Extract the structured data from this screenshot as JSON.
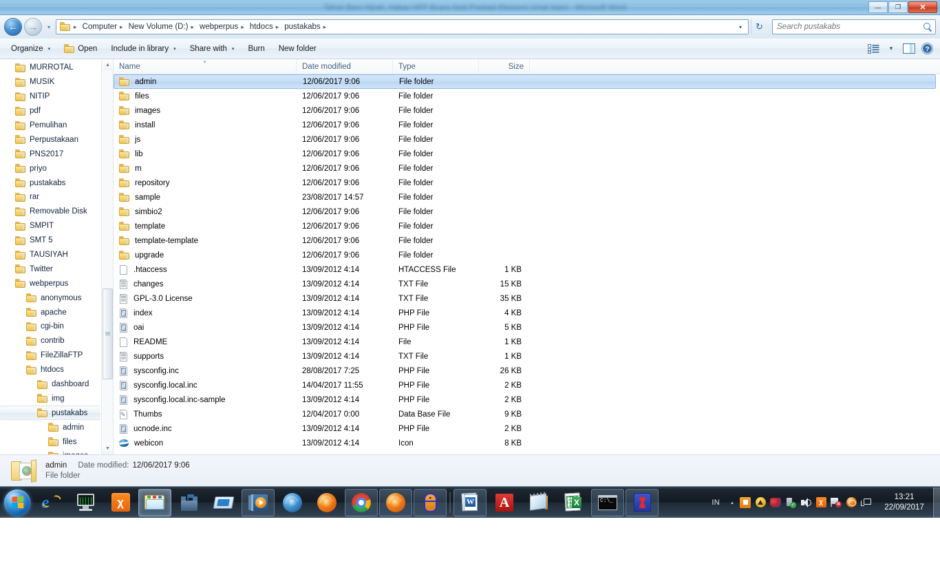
{
  "background_window": {
    "title": "Tahun Baru Hijrah, Hakau HPP Bcara Soal Prestasi Ekonomi Umat Islam - Microsoft Word",
    "minimize_label": "—",
    "restore_label": "❐",
    "close_label": "✕"
  },
  "explorer": {
    "nav": {
      "back_label": "←",
      "forward_label": "→",
      "history_label": "▾"
    },
    "breadcrumb": {
      "separator": "▸",
      "items": [
        "Computer",
        "New Volume (D:)",
        "webperpus",
        "htdocs",
        "pustakabs"
      ],
      "dropdown_label": "▾",
      "refresh_label": "↻"
    },
    "search": {
      "placeholder": "Search pustakabs",
      "value": ""
    },
    "toolbar": {
      "organize": "Organize",
      "open": "Open",
      "include_in_library": "Include in library",
      "share_with": "Share with",
      "burn": "Burn",
      "new_folder": "New folder",
      "caret": "▾",
      "view_icon": "view-options-icon",
      "preview_icon": "preview-pane-icon",
      "help_icon": "help-icon",
      "help_label": "?"
    },
    "sidebar": {
      "items": [
        {
          "label": "MURROTAL",
          "indent": 1
        },
        {
          "label": "MUSIK",
          "indent": 1
        },
        {
          "label": "NITIP",
          "indent": 1
        },
        {
          "label": "pdf",
          "indent": 1
        },
        {
          "label": "Pemulihan",
          "indent": 1
        },
        {
          "label": "Perpustakaan",
          "indent": 1
        },
        {
          "label": "PNS2017",
          "indent": 1
        },
        {
          "label": "priyo",
          "indent": 1
        },
        {
          "label": "pustakabs",
          "indent": 1
        },
        {
          "label": "rar",
          "indent": 1
        },
        {
          "label": "Removable Disk",
          "indent": 1
        },
        {
          "label": "SMPIT",
          "indent": 1
        },
        {
          "label": "SMT 5",
          "indent": 1
        },
        {
          "label": "TAUSIYAH",
          "indent": 1
        },
        {
          "label": "Twitter",
          "indent": 1
        },
        {
          "label": "webperpus",
          "indent": 1
        },
        {
          "label": "anonymous",
          "indent": 2
        },
        {
          "label": "apache",
          "indent": 2
        },
        {
          "label": "cgi-bin",
          "indent": 2
        },
        {
          "label": "contrib",
          "indent": 2
        },
        {
          "label": "FileZillaFTP",
          "indent": 2
        },
        {
          "label": "htdocs",
          "indent": 2
        },
        {
          "label": "dashboard",
          "indent": 3
        },
        {
          "label": "img",
          "indent": 3
        },
        {
          "label": "pustakabs",
          "indent": 3,
          "selected": true
        },
        {
          "label": "admin",
          "indent": 4
        },
        {
          "label": "files",
          "indent": 4
        },
        {
          "label": "images",
          "indent": 4
        }
      ],
      "scroll_up_label": "▲",
      "scroll_down_label": "▼"
    },
    "columns": [
      {
        "key": "name",
        "label": "Name",
        "sorted": "asc",
        "sort_glyph": "▴"
      },
      {
        "key": "date",
        "label": "Date modified"
      },
      {
        "key": "type",
        "label": "Type"
      },
      {
        "key": "size",
        "label": "Size"
      }
    ],
    "files": [
      {
        "name": "admin",
        "date": "12/06/2017 9:06",
        "type": "File folder",
        "size": "",
        "icon": "folder",
        "selected": true
      },
      {
        "name": "files",
        "date": "12/06/2017 9:06",
        "type": "File folder",
        "size": "",
        "icon": "folder"
      },
      {
        "name": "images",
        "date": "12/06/2017 9:06",
        "type": "File folder",
        "size": "",
        "icon": "folder"
      },
      {
        "name": "install",
        "date": "12/06/2017 9:06",
        "type": "File folder",
        "size": "",
        "icon": "folder"
      },
      {
        "name": "js",
        "date": "12/06/2017 9:06",
        "type": "File folder",
        "size": "",
        "icon": "folder"
      },
      {
        "name": "lib",
        "date": "12/06/2017 9:06",
        "type": "File folder",
        "size": "",
        "icon": "folder"
      },
      {
        "name": "m",
        "date": "12/06/2017 9:06",
        "type": "File folder",
        "size": "",
        "icon": "folder"
      },
      {
        "name": "repository",
        "date": "12/06/2017 9:06",
        "type": "File folder",
        "size": "",
        "icon": "folder"
      },
      {
        "name": "sample",
        "date": "23/08/2017 14:57",
        "type": "File folder",
        "size": "",
        "icon": "folder"
      },
      {
        "name": "simbio2",
        "date": "12/06/2017 9:06",
        "type": "File folder",
        "size": "",
        "icon": "folder"
      },
      {
        "name": "template",
        "date": "12/06/2017 9:06",
        "type": "File folder",
        "size": "",
        "icon": "folder"
      },
      {
        "name": "template-template",
        "date": "12/06/2017 9:06",
        "type": "File folder",
        "size": "",
        "icon": "folder"
      },
      {
        "name": "upgrade",
        "date": "12/06/2017 9:06",
        "type": "File folder",
        "size": "",
        "icon": "folder"
      },
      {
        "name": ".htaccess",
        "date": "13/09/2012 4:14",
        "type": "HTACCESS File",
        "size": "1 KB",
        "icon": "doc-plain"
      },
      {
        "name": "changes",
        "date": "13/09/2012 4:14",
        "type": "TXT File",
        "size": "15 KB",
        "icon": "doc-txt"
      },
      {
        "name": "GPL-3.0 License",
        "date": "13/09/2012 4:14",
        "type": "TXT File",
        "size": "35 KB",
        "icon": "doc-txt"
      },
      {
        "name": "index",
        "date": "13/09/2012 4:14",
        "type": "PHP File",
        "size": "4 KB",
        "icon": "doc-php"
      },
      {
        "name": "oai",
        "date": "13/09/2012 4:14",
        "type": "PHP File",
        "size": "5 KB",
        "icon": "doc-php"
      },
      {
        "name": "README",
        "date": "13/09/2012 4:14",
        "type": "File",
        "size": "1 KB",
        "icon": "doc-plain"
      },
      {
        "name": "supports",
        "date": "13/09/2012 4:14",
        "type": "TXT File",
        "size": "1 KB",
        "icon": "doc-txt"
      },
      {
        "name": "sysconfig.inc",
        "date": "28/08/2017 7:25",
        "type": "PHP File",
        "size": "26 KB",
        "icon": "doc-php"
      },
      {
        "name": "sysconfig.local.inc",
        "date": "14/04/2017 11:55",
        "type": "PHP File",
        "size": "2 KB",
        "icon": "doc-php"
      },
      {
        "name": "sysconfig.local.inc-sample",
        "date": "13/09/2012 4:14",
        "type": "PHP File",
        "size": "2 KB",
        "icon": "doc-php"
      },
      {
        "name": "Thumbs",
        "date": "12/04/2017 0:00",
        "type": "Data Base File",
        "size": "9 KB",
        "icon": "doc-db"
      },
      {
        "name": "ucnode.inc",
        "date": "13/09/2012 4:14",
        "type": "PHP File",
        "size": "2 KB",
        "icon": "doc-php"
      },
      {
        "name": "webicon",
        "date": "13/09/2012 4:14",
        "type": "Icon",
        "size": "8 KB",
        "icon": "icon-web"
      }
    ],
    "details": {
      "name": "admin",
      "date_label": "Date modified:",
      "date_value": "12/06/2017 9:06",
      "type": "File folder"
    }
  },
  "taskbar": {
    "start_label": "start-orb",
    "items": [
      {
        "name": "internet-explorer",
        "icon": "ie"
      },
      {
        "name": "system-monitor",
        "icon": "monitor"
      },
      {
        "name": "xampp",
        "icon": "xampp",
        "glyph": "χ"
      },
      {
        "name": "windows-explorer",
        "icon": "explorer",
        "state": "active"
      },
      {
        "name": "firewall-castle",
        "icon": "castle"
      },
      {
        "name": "window-app",
        "icon": "window"
      },
      {
        "name": "windows-media-player",
        "icon": "wmp",
        "state": "running"
      },
      {
        "name": "firefox-blue",
        "icon": "firefox-blue"
      },
      {
        "name": "firefox-orange",
        "icon": "firefox-orange"
      },
      {
        "name": "google-chrome",
        "icon": "chrome",
        "state": "running"
      },
      {
        "name": "firefox",
        "icon": "firefox-orange",
        "state": "running"
      },
      {
        "name": "mouse-utility",
        "icon": "mouse",
        "state": "running"
      },
      {
        "separator": true
      },
      {
        "name": "microsoft-word",
        "icon": "word",
        "state": "running"
      },
      {
        "name": "adobe-reader",
        "icon": "pdf",
        "glyph": "A"
      },
      {
        "name": "notepad",
        "icon": "notepad"
      },
      {
        "name": "microsoft-excel",
        "icon": "excel",
        "glyph": "X"
      },
      {
        "name": "command-prompt",
        "icon": "cmd",
        "state": "running"
      },
      {
        "name": "huawei-mobile",
        "icon": "huawei",
        "state": "running"
      }
    ],
    "tray": {
      "language": "IN",
      "expand_label": "▴",
      "icons": [
        {
          "name": "orange-square-icon",
          "icon": "square"
        },
        {
          "name": "warning-icon",
          "icon": "warn"
        },
        {
          "name": "connectify-icon",
          "icon": "cm"
        },
        {
          "name": "usb-safely-remove-icon",
          "icon": "usb",
          "glyph": "✓"
        },
        {
          "name": "volume-icon",
          "icon": "speaker"
        },
        {
          "name": "xampp-tray-icon",
          "icon": "xampp",
          "glyph": "χ"
        },
        {
          "name": "action-center-flag-icon",
          "icon": "flag",
          "glyph": "✕"
        },
        {
          "name": "firefox-tray-icon",
          "icon": "globe"
        },
        {
          "name": "network-icon",
          "icon": "network"
        }
      ],
      "clock_time": "13:21",
      "clock_date": "22/09/2017"
    },
    "show_desktop_label": "show-desktop"
  }
}
